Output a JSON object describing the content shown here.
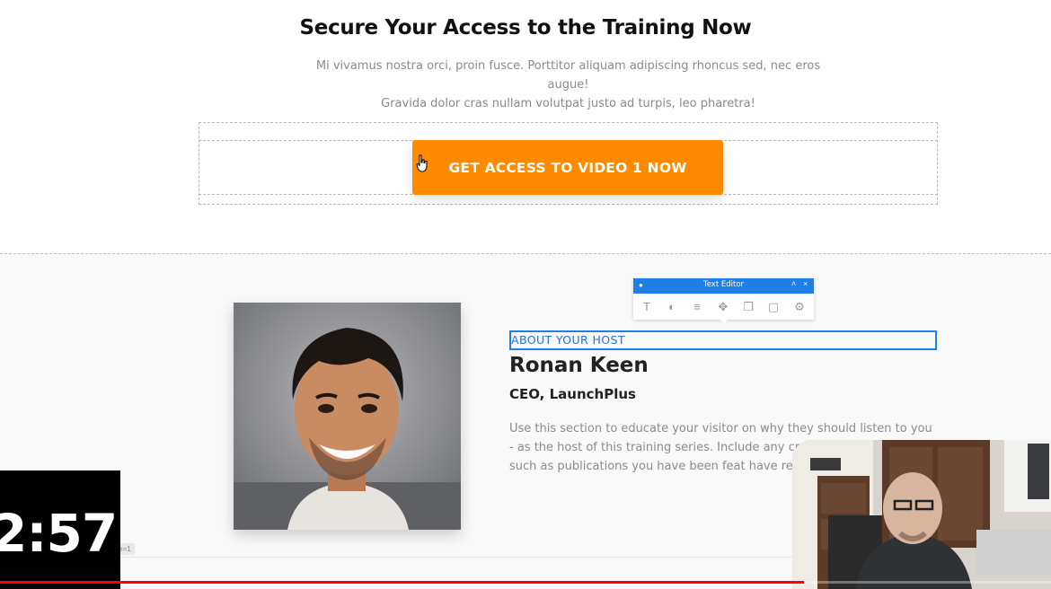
{
  "cta_section": {
    "title": "Secure Your Access to the Training Now",
    "subtitle_line1": "Mi vivamus nostra orci, proin fusce. Porttitor aliquam adipiscing rhoncus sed, nec eros augue!",
    "subtitle_line2": "Gravida dolor cras nullam volutpat justo ad turpis, leo pharetra!",
    "button_label": "GET ACCESS TO VIDEO 1 NOW",
    "button_color": "#ff8a00"
  },
  "text_editor_toolbar": {
    "title": "Text Editor",
    "header_color": "#1e7fe6",
    "tools": [
      "text-type-icon",
      "palette-icon",
      "align-center-icon",
      "move-icon",
      "duplicate-icon",
      "trash-icon",
      "gear-icon"
    ]
  },
  "host_section": {
    "eyebrow": "ABOUT YOUR HOST",
    "name": "Ronan Keen",
    "role": "CEO, LaunchPlus",
    "bio": "Use this section to educate your visitor on why they should listen to you - as the host of this training series.  Include any credentials information such as publications you have been feat have received."
  },
  "overlay": {
    "timer": "2:57",
    "tag": "e=1",
    "progress_fraction": 0.765,
    "progress_color": "#ff0000"
  }
}
